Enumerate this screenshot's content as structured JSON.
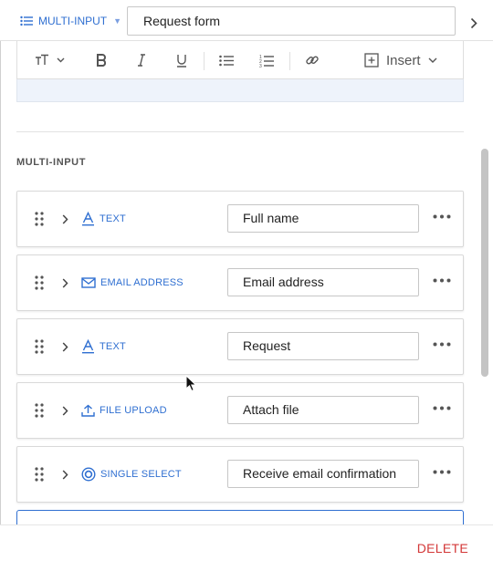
{
  "header": {
    "type_switch_label": "MULTI-INPUT",
    "title_value": "Request form"
  },
  "toolbar": {
    "insert_label": "Insert"
  },
  "section": {
    "label": "MULTI-INPUT"
  },
  "rows": [
    {
      "type_label": "TEXT",
      "type_icon": "text-icon",
      "value": "Full name"
    },
    {
      "type_label": "EMAIL ADDRESS",
      "type_icon": "envelope-icon",
      "value": "Email address"
    },
    {
      "type_label": "TEXT",
      "type_icon": "text-icon",
      "value": "Request"
    },
    {
      "type_label": "FILE UPLOAD",
      "type_icon": "upload-icon",
      "value": "Attach file"
    },
    {
      "type_label": "SINGLE SELECT",
      "type_icon": "radio-icon",
      "value": "Receive email confirmation"
    }
  ],
  "footer": {
    "delete_label": "DELETE"
  },
  "colors": {
    "accent": "#2f6fd1",
    "danger": "#d33838",
    "editor_bg": "#eef3fb"
  }
}
